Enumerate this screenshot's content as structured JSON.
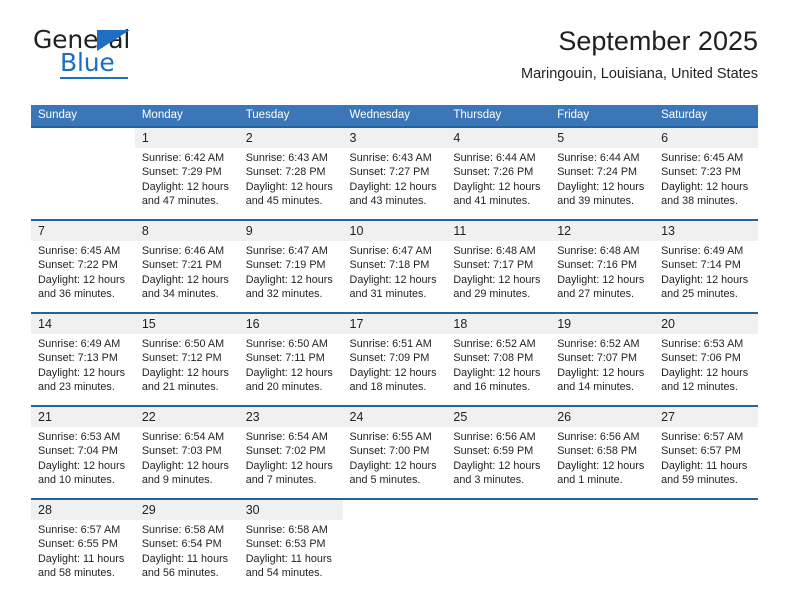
{
  "brand": {
    "name_top": "General",
    "name_bottom": "Blue",
    "accent_color": "#1f6fc0"
  },
  "header": {
    "title": "September 2025",
    "subtitle": "Maringouin, Louisiana, United States",
    "header_bg": "#3b77b8",
    "daynum_bg": "#f0f0f0",
    "separator_color": "#21649e"
  },
  "weekdays": [
    "Sunday",
    "Monday",
    "Tuesday",
    "Wednesday",
    "Thursday",
    "Friday",
    "Saturday"
  ],
  "labels": {
    "sunrise": "Sunrise:",
    "sunset": "Sunset:",
    "daylight": "Daylight:"
  },
  "weeks": [
    [
      {
        "day": "",
        "sunrise": "",
        "sunset": "",
        "daylight": ""
      },
      {
        "day": "1",
        "sunrise": "Sunrise: 6:42 AM",
        "sunset": "Sunset: 7:29 PM",
        "daylight": "Daylight: 12 hours and 47 minutes."
      },
      {
        "day": "2",
        "sunrise": "Sunrise: 6:43 AM",
        "sunset": "Sunset: 7:28 PM",
        "daylight": "Daylight: 12 hours and 45 minutes."
      },
      {
        "day": "3",
        "sunrise": "Sunrise: 6:43 AM",
        "sunset": "Sunset: 7:27 PM",
        "daylight": "Daylight: 12 hours and 43 minutes."
      },
      {
        "day": "4",
        "sunrise": "Sunrise: 6:44 AM",
        "sunset": "Sunset: 7:26 PM",
        "daylight": "Daylight: 12 hours and 41 minutes."
      },
      {
        "day": "5",
        "sunrise": "Sunrise: 6:44 AM",
        "sunset": "Sunset: 7:24 PM",
        "daylight": "Daylight: 12 hours and 39 minutes."
      },
      {
        "day": "6",
        "sunrise": "Sunrise: 6:45 AM",
        "sunset": "Sunset: 7:23 PM",
        "daylight": "Daylight: 12 hours and 38 minutes."
      }
    ],
    [
      {
        "day": "7",
        "sunrise": "Sunrise: 6:45 AM",
        "sunset": "Sunset: 7:22 PM",
        "daylight": "Daylight: 12 hours and 36 minutes."
      },
      {
        "day": "8",
        "sunrise": "Sunrise: 6:46 AM",
        "sunset": "Sunset: 7:21 PM",
        "daylight": "Daylight: 12 hours and 34 minutes."
      },
      {
        "day": "9",
        "sunrise": "Sunrise: 6:47 AM",
        "sunset": "Sunset: 7:19 PM",
        "daylight": "Daylight: 12 hours and 32 minutes."
      },
      {
        "day": "10",
        "sunrise": "Sunrise: 6:47 AM",
        "sunset": "Sunset: 7:18 PM",
        "daylight": "Daylight: 12 hours and 31 minutes."
      },
      {
        "day": "11",
        "sunrise": "Sunrise: 6:48 AM",
        "sunset": "Sunset: 7:17 PM",
        "daylight": "Daylight: 12 hours and 29 minutes."
      },
      {
        "day": "12",
        "sunrise": "Sunrise: 6:48 AM",
        "sunset": "Sunset: 7:16 PM",
        "daylight": "Daylight: 12 hours and 27 minutes."
      },
      {
        "day": "13",
        "sunrise": "Sunrise: 6:49 AM",
        "sunset": "Sunset: 7:14 PM",
        "daylight": "Daylight: 12 hours and 25 minutes."
      }
    ],
    [
      {
        "day": "14",
        "sunrise": "Sunrise: 6:49 AM",
        "sunset": "Sunset: 7:13 PM",
        "daylight": "Daylight: 12 hours and 23 minutes."
      },
      {
        "day": "15",
        "sunrise": "Sunrise: 6:50 AM",
        "sunset": "Sunset: 7:12 PM",
        "daylight": "Daylight: 12 hours and 21 minutes."
      },
      {
        "day": "16",
        "sunrise": "Sunrise: 6:50 AM",
        "sunset": "Sunset: 7:11 PM",
        "daylight": "Daylight: 12 hours and 20 minutes."
      },
      {
        "day": "17",
        "sunrise": "Sunrise: 6:51 AM",
        "sunset": "Sunset: 7:09 PM",
        "daylight": "Daylight: 12 hours and 18 minutes."
      },
      {
        "day": "18",
        "sunrise": "Sunrise: 6:52 AM",
        "sunset": "Sunset: 7:08 PM",
        "daylight": "Daylight: 12 hours and 16 minutes."
      },
      {
        "day": "19",
        "sunrise": "Sunrise: 6:52 AM",
        "sunset": "Sunset: 7:07 PM",
        "daylight": "Daylight: 12 hours and 14 minutes."
      },
      {
        "day": "20",
        "sunrise": "Sunrise: 6:53 AM",
        "sunset": "Sunset: 7:06 PM",
        "daylight": "Daylight: 12 hours and 12 minutes."
      }
    ],
    [
      {
        "day": "21",
        "sunrise": "Sunrise: 6:53 AM",
        "sunset": "Sunset: 7:04 PM",
        "daylight": "Daylight: 12 hours and 10 minutes."
      },
      {
        "day": "22",
        "sunrise": "Sunrise: 6:54 AM",
        "sunset": "Sunset: 7:03 PM",
        "daylight": "Daylight: 12 hours and 9 minutes."
      },
      {
        "day": "23",
        "sunrise": "Sunrise: 6:54 AM",
        "sunset": "Sunset: 7:02 PM",
        "daylight": "Daylight: 12 hours and 7 minutes."
      },
      {
        "day": "24",
        "sunrise": "Sunrise: 6:55 AM",
        "sunset": "Sunset: 7:00 PM",
        "daylight": "Daylight: 12 hours and 5 minutes."
      },
      {
        "day": "25",
        "sunrise": "Sunrise: 6:56 AM",
        "sunset": "Sunset: 6:59 PM",
        "daylight": "Daylight: 12 hours and 3 minutes."
      },
      {
        "day": "26",
        "sunrise": "Sunrise: 6:56 AM",
        "sunset": "Sunset: 6:58 PM",
        "daylight": "Daylight: 12 hours and 1 minute."
      },
      {
        "day": "27",
        "sunrise": "Sunrise: 6:57 AM",
        "sunset": "Sunset: 6:57 PM",
        "daylight": "Daylight: 11 hours and 59 minutes."
      }
    ],
    [
      {
        "day": "28",
        "sunrise": "Sunrise: 6:57 AM",
        "sunset": "Sunset: 6:55 PM",
        "daylight": "Daylight: 11 hours and 58 minutes."
      },
      {
        "day": "29",
        "sunrise": "Sunrise: 6:58 AM",
        "sunset": "Sunset: 6:54 PM",
        "daylight": "Daylight: 11 hours and 56 minutes."
      },
      {
        "day": "30",
        "sunrise": "Sunrise: 6:58 AM",
        "sunset": "Sunset: 6:53 PM",
        "daylight": "Daylight: 11 hours and 54 minutes."
      },
      {
        "day": "",
        "sunrise": "",
        "sunset": "",
        "daylight": ""
      },
      {
        "day": "",
        "sunrise": "",
        "sunset": "",
        "daylight": ""
      },
      {
        "day": "",
        "sunrise": "",
        "sunset": "",
        "daylight": ""
      },
      {
        "day": "",
        "sunrise": "",
        "sunset": "",
        "daylight": ""
      }
    ]
  ]
}
